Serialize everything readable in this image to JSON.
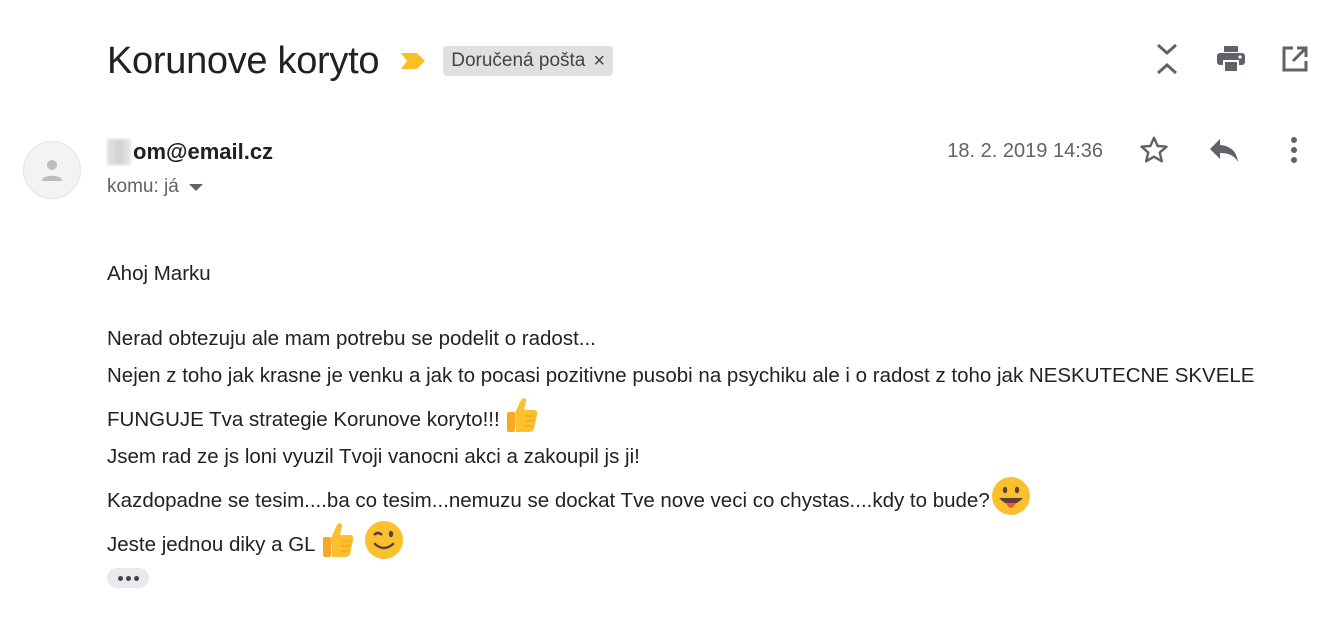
{
  "header": {
    "subject": "Korunove koryto",
    "label": "Doručená pošta",
    "label_close": "×"
  },
  "message": {
    "sender_email": "om@email.cz",
    "recipient_prefix": "komu: já",
    "date": "18. 2. 2019 14:36",
    "greeting": "Ahoj Marku",
    "lines": [
      "Nerad obtezuju ale mam potrebu se podelit o radost...",
      "Nejen z toho jak krasne je venku a jak to pocasi pozitivne pusobi na psychiku ale i o radost z toho jak NESKUTECNE SKVELE FUNGUJE Tva strategie Korunove koryto!!!",
      "Jsem rad ze js loni vyuzil Tvoji vanocni akci a zakoupil js ji!",
      "Kazdopadne se tesim....ba co tesim...nemuzu se dockat Tve nove veci co chystas....kdy to bude?",
      "Jeste jednou diky a GL"
    ]
  },
  "icons": {
    "expand_collapse": "unfold-less-icon",
    "print": "print-icon",
    "open_new_window": "open-in-new-icon",
    "star": "star-outline-icon",
    "reply": "reply-icon",
    "more": "more-vert-icon",
    "avatar": "person-icon",
    "importance": "importance-marker-icon"
  },
  "colors": {
    "importance_marker": "#f6c026",
    "label_bg": "#e0e0e0",
    "emoji_face": "#fbc02d"
  }
}
